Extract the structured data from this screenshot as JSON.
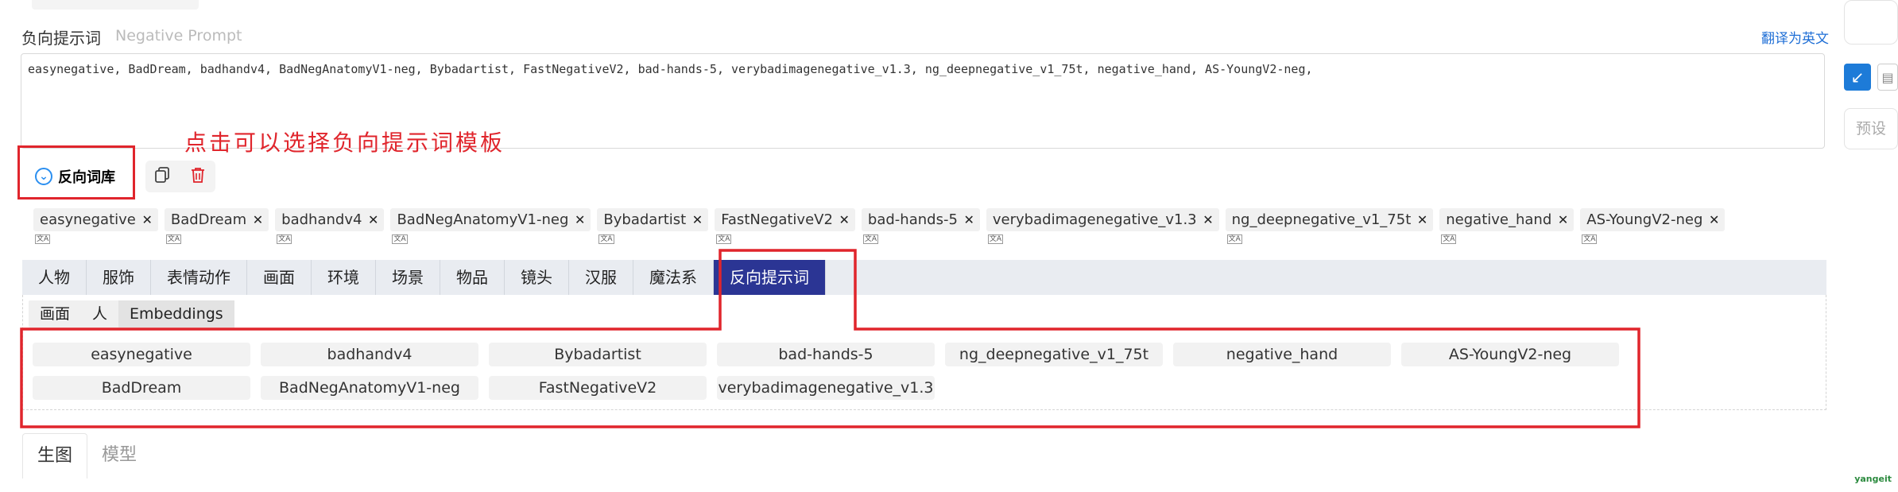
{
  "header": {
    "title": "负向提示词",
    "subtitle": "Negative Prompt",
    "translate_label": "翻译为英文"
  },
  "prompt": {
    "value": "easynegative, BadDream, badhandv4, BadNegAnatomyV1-neg, Bybadartist, FastNegativeV2, bad-hands-5, verybadimagenegative_v1.3, ng_deepnegative_v1_75t, negative_hand, AS-YoungV2-neg,"
  },
  "annotation": {
    "text": "点击可以选择负向提示词模板",
    "color": "#e0252c"
  },
  "library": {
    "toggle_label": "反向词库",
    "copy_icon": "copy-icon",
    "delete_icon": "trash-icon"
  },
  "selected_tags": [
    {
      "label": "easynegative"
    },
    {
      "label": "BadDream"
    },
    {
      "label": "badhandv4"
    },
    {
      "label": "BadNegAnatomyV1-neg"
    },
    {
      "label": "Bybadartist"
    },
    {
      "label": "FastNegativeV2"
    },
    {
      "label": "bad-hands-5"
    },
    {
      "label": "verybadimagenegative_v1.3"
    },
    {
      "label": "ng_deepnegative_v1_75t"
    },
    {
      "label": "negative_hand"
    },
    {
      "label": "AS-YoungV2-neg"
    }
  ],
  "category_tabs": [
    {
      "label": "人物"
    },
    {
      "label": "服饰"
    },
    {
      "label": "表情动作"
    },
    {
      "label": "画面"
    },
    {
      "label": "环境"
    },
    {
      "label": "场景"
    },
    {
      "label": "物品"
    },
    {
      "label": "镜头"
    },
    {
      "label": "汉服"
    },
    {
      "label": "魔法系"
    },
    {
      "label": "反向提示词",
      "active": true
    }
  ],
  "sub_tabs": [
    {
      "label": "画面"
    },
    {
      "label": "人"
    },
    {
      "label": "Embeddings",
      "active": true
    }
  ],
  "embeddings": [
    [
      "easynegative",
      "badhandv4",
      "Bybadartist",
      "bad-hands-5",
      "ng_deepnegative_v1_75t",
      "negative_hand",
      "AS-YoungV2-neg"
    ],
    [
      "BadDream",
      "BadNegAnatomyV1-neg",
      "FastNegativeV2",
      "verybadimagenegative_v1.3"
    ]
  ],
  "bottom_tabs": [
    {
      "label": "生图",
      "active": true
    },
    {
      "label": "模型"
    }
  ],
  "right_panel": {
    "preset_label": "预设"
  },
  "watermark": "yangeit",
  "colors": {
    "active_tab": "#2b3594",
    "annotation_red": "#e0252c",
    "link_blue": "#1f6fd6"
  }
}
